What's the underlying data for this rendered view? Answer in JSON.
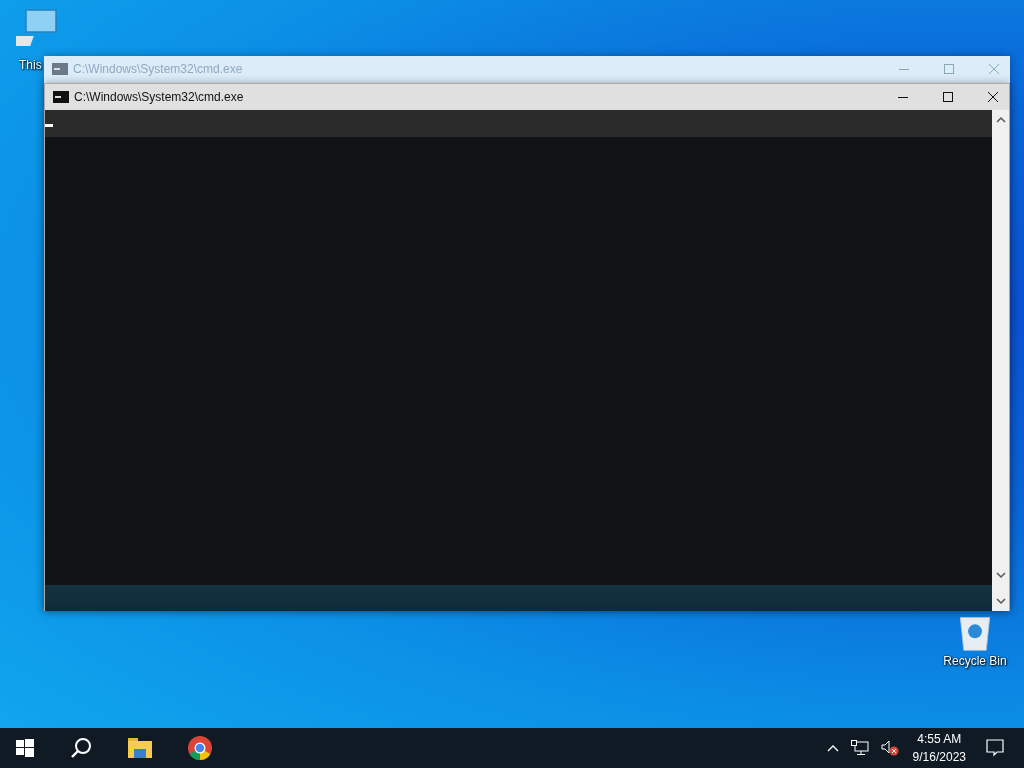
{
  "desktop_icons": [
    {
      "kind": "computer",
      "label": "This"
    },
    {
      "kind": "recycle",
      "label": "Recycle Bin"
    }
  ],
  "windows": [
    {
      "title": "C:\\Windows\\System32\\cmd.exe",
      "active": false
    },
    {
      "title": "C:\\Windows\\System32\\cmd.exe",
      "active": true
    }
  ],
  "clock": {
    "time": "4:55 AM",
    "date": "9/16/2023"
  }
}
